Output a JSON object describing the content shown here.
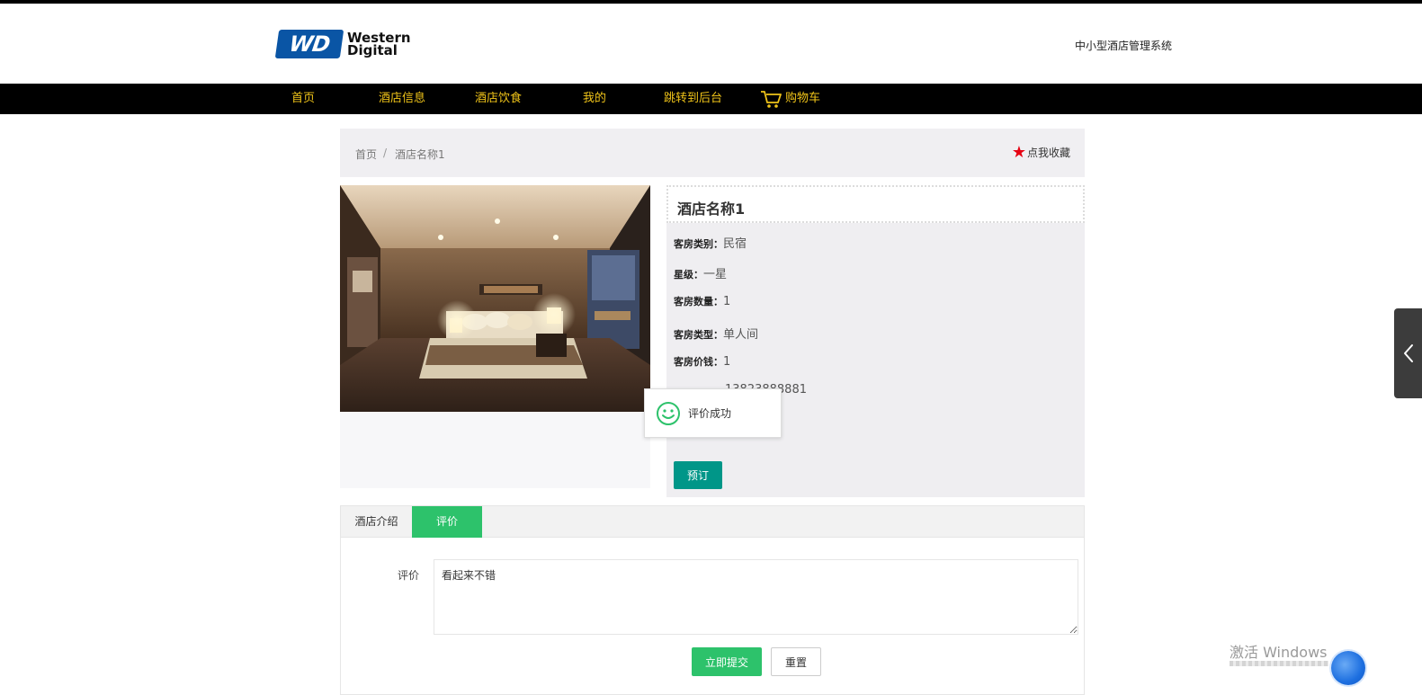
{
  "header": {
    "logo_line1": "Western",
    "logo_line2": "Digital",
    "system_title": "中小型酒店管理系统"
  },
  "nav": {
    "items": [
      {
        "label": "首页"
      },
      {
        "label": "酒店信息"
      },
      {
        "label": "酒店饮食"
      },
      {
        "label": "我的"
      },
      {
        "label": "跳转到后台"
      },
      {
        "label": "购物车"
      }
    ]
  },
  "breadcrumb": {
    "home": "首页",
    "separator": "/",
    "current": "酒店名称1",
    "favorite_label": "点我收藏"
  },
  "detail": {
    "title": "酒店名称1",
    "fields": [
      {
        "key": "客房类别：",
        "value": "民宿"
      },
      {
        "key": "星级：",
        "value": "一星"
      },
      {
        "key": "客房数量：",
        "value": "1"
      },
      {
        "key": "客房类型：",
        "value": "单人间"
      },
      {
        "key": "客房价钱：",
        "value": "1"
      },
      {
        "key": "",
        "value": "13823888881"
      }
    ],
    "book_label": "预订"
  },
  "toast": {
    "message": "评价成功"
  },
  "tabs": {
    "items": [
      {
        "label": "酒店介绍",
        "active": false
      },
      {
        "label": "评价",
        "active": true
      }
    ]
  },
  "review": {
    "label": "评价",
    "value": "看起来不错",
    "submit_label": "立即提交",
    "reset_label": "重置"
  },
  "watermark": {
    "text": "激活 Windows"
  },
  "colors": {
    "nav_bg": "#000000",
    "nav_text": "#f0c419",
    "primary_green": "#2dc26b",
    "teal_button": "#009688",
    "favorite_star": "#e60012",
    "logo_blue": "#0a55a5"
  }
}
